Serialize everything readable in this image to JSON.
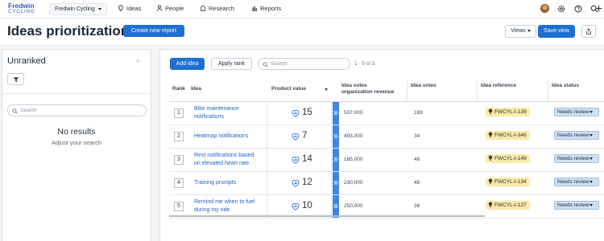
{
  "nav": {
    "logo_line1": "Fredwin",
    "logo_line2": "CYCLING",
    "workspace": "Fredwin Cycling",
    "items": [
      "Ideas",
      "People",
      "Research",
      "Reports"
    ]
  },
  "header": {
    "title": "Ideas prioritization",
    "create_button": "Create new report",
    "views_button": "Views",
    "save_button": "Save view"
  },
  "left": {
    "title": "Unranked",
    "search_placeholder": "Search",
    "no_results": "No results",
    "hint": "Adjust your search"
  },
  "toolbar": {
    "add_button": "Add idea",
    "apply_rank_button": "Apply rank",
    "search_placeholder": "Search",
    "count": "1 - 5 of 5"
  },
  "table": {
    "columns": {
      "rank": "Rank",
      "idea": "Idea",
      "product_value": "Product value",
      "votes_org_line1": "Idea votes",
      "votes_org_line2": "organization revenue",
      "votes": "Idea votes",
      "reference": "Idea reference",
      "status": "Idea status"
    },
    "rows": [
      {
        "rank": "1",
        "name_line1": "Bike maintenance",
        "name_line2": "notifications",
        "value": "15",
        "org_revenue": "537,000",
        "votes": "189",
        "reference": "FWCYL-I-139",
        "status": "Needs review"
      },
      {
        "rank": "2",
        "name_line1": "Heatmap notifications",
        "name_line2": "",
        "value": "7",
        "org_revenue": "493,000",
        "votes": "34",
        "reference": "FWCYL-I-346",
        "status": "Needs review"
      },
      {
        "rank": "3",
        "name_line1": "Rest notifications based",
        "name_line2": "on elevated heart rate",
        "value": "14",
        "org_revenue": "185,000",
        "votes": "46",
        "reference": "FWCYL-I-149",
        "status": "Needs review"
      },
      {
        "rank": "4",
        "name_line1": "Training prompts",
        "name_line2": "",
        "value": "12",
        "org_revenue": "230,000",
        "votes": "48",
        "reference": "FWCYL-I-134",
        "status": "Needs review"
      },
      {
        "rank": "5",
        "name_line1": "Remind me when to fuel",
        "name_line2": "during my ride",
        "value": "10",
        "org_revenue": "250,000",
        "votes": "36",
        "reference": "FWCYL-I-127",
        "status": "Needs review"
      }
    ]
  },
  "icons": {
    "nav_ideas": "lightbulb-icon",
    "nav_people": "person-icon",
    "nav_research": "research-icon",
    "nav_reports": "bar-chart-icon",
    "settings": "gear-icon",
    "help": "help-icon",
    "search": "search-icon",
    "add": "plus-icon",
    "share": "share-icon",
    "filter": "filter-icon",
    "collapse": "double-chevron-left-icon",
    "score": "scorecard-icon",
    "expand": "double-chevron-right-icon",
    "reference": "lightbulb-icon"
  },
  "colors": {
    "primary": "#1f6fd1",
    "link": "#1f63c4",
    "reference_badge": "#fbe9a6",
    "status_badge": "#cfe0f2",
    "column_accent": "#3d87e0"
  }
}
